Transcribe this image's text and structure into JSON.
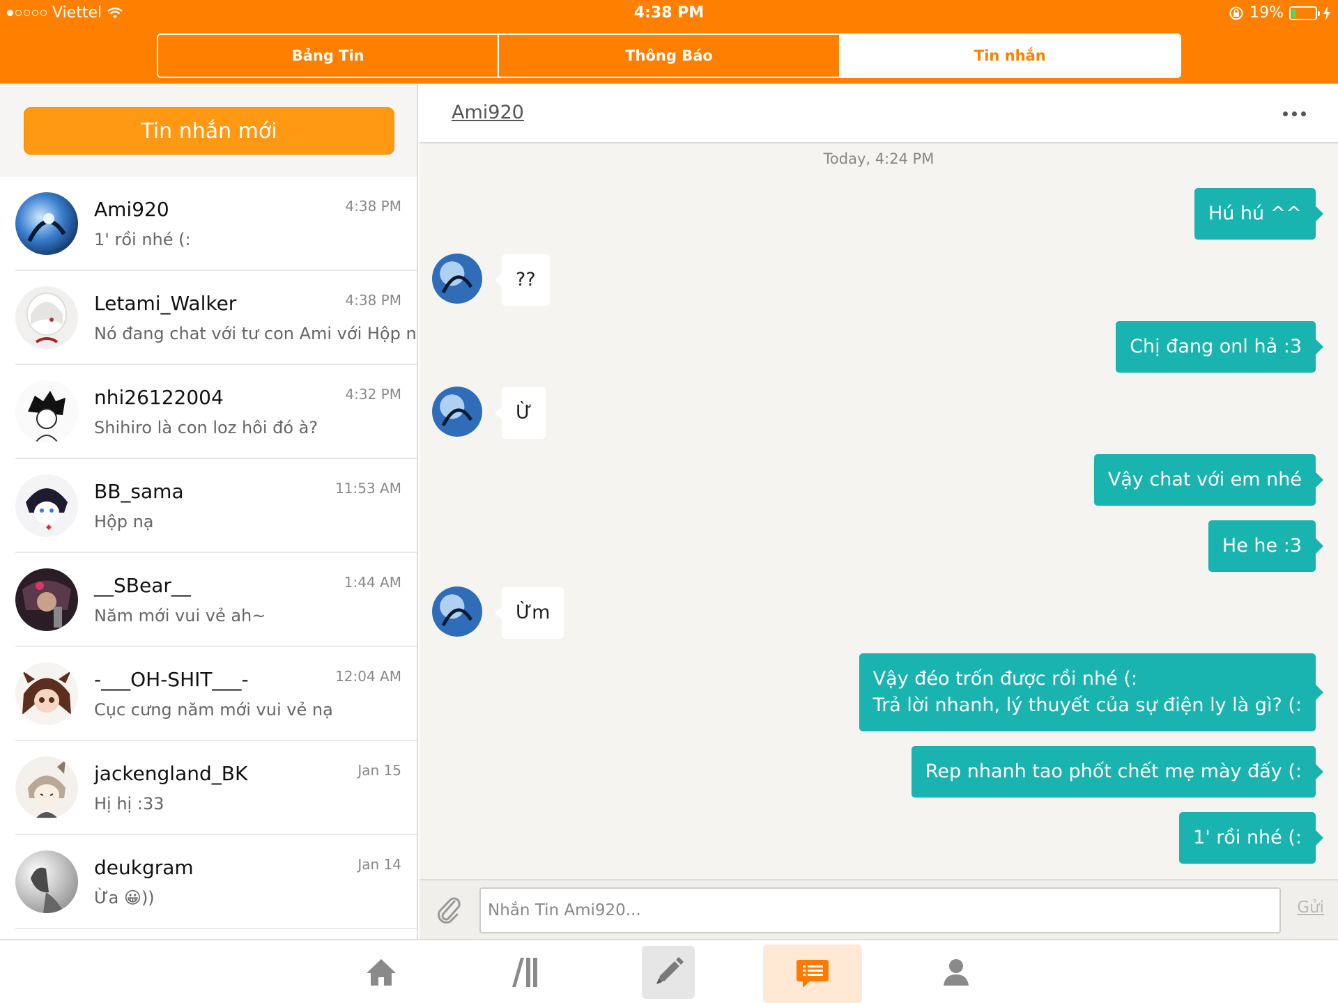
{
  "status_bar": {
    "carrier": "Viettel",
    "time": "4:38 PM",
    "battery": "19%",
    "battery_level": 0.19
  },
  "top_tabs": [
    {
      "label": "Bảng Tin",
      "active": false
    },
    {
      "label": "Thông Báo",
      "active": false
    },
    {
      "label": "Tin nhắn",
      "active": true
    }
  ],
  "sidebar": {
    "new_message_label": "Tin nhắn mới",
    "conversations": [
      {
        "name": "Ami920",
        "preview": "1' rồi nhé (:",
        "time": "4:38 PM"
      },
      {
        "name": "Letami_Walker",
        "preview": "Nó đang chat với tư  con Ami với Hộp nè",
        "time": "4:38 PM"
      },
      {
        "name": "nhi26122004",
        "preview": "Shihiro là con loz hôi đó à?",
        "time": "4:32 PM"
      },
      {
        "name": "BB_sama",
        "preview": "Hộp nạ",
        "time": "11:53 AM"
      },
      {
        "name": "__SBear__",
        "preview": "Năm mới vui vẻ ah~",
        "time": "1:44 AM"
      },
      {
        "name": "-___OH-SHIT___-",
        "preview": "Cục cưng năm mới vui vẻ nạ",
        "time": "12:04 AM"
      },
      {
        "name": "jackengland_BK",
        "preview": "Hị hị :33",
        "time": "Jan 15"
      },
      {
        "name": "deukgram",
        "preview": "Ừa 😀))",
        "time": "Jan 14"
      }
    ]
  },
  "chat": {
    "title": "Ami920",
    "date_divider": "Today, 4:24 PM",
    "messages": [
      {
        "dir": "out",
        "text": "Hú hú ^^"
      },
      {
        "dir": "in",
        "text": "??"
      },
      {
        "dir": "out",
        "text": "Chị đang onl hả :3"
      },
      {
        "dir": "in",
        "text": "Ừ"
      },
      {
        "dir": "out",
        "text": "Vậy chat với em nhé"
      },
      {
        "dir": "out",
        "text": "He he :3"
      },
      {
        "dir": "in",
        "text": "Ừm"
      },
      {
        "dir": "out",
        "text": "Vậy đéo trốn được rồi nhé (:\nTrả lời nhanh, lý thuyết của sự điện ly là gì? (:"
      },
      {
        "dir": "out",
        "text": "Rep nhanh tao phốt chết mẹ mày đấy (:"
      },
      {
        "dir": "out",
        "text": "1' rồi nhé (:"
      }
    ],
    "input_placeholder": "Nhắn Tin Ami920...",
    "send_label": "Gửi"
  },
  "bottom_tabs": [
    {
      "icon": "home-icon",
      "active": false
    },
    {
      "icon": "library-icon",
      "active": false
    },
    {
      "icon": "pencil-icon",
      "active": false
    },
    {
      "icon": "messages-icon",
      "active": true
    },
    {
      "icon": "profile-icon",
      "active": false
    }
  ],
  "colors": {
    "brand_orange": "#ff8000",
    "new_message_button": "#ff9812",
    "outgoing_bubble": "#19b3b0",
    "chat_background": "#f5f4f1"
  }
}
